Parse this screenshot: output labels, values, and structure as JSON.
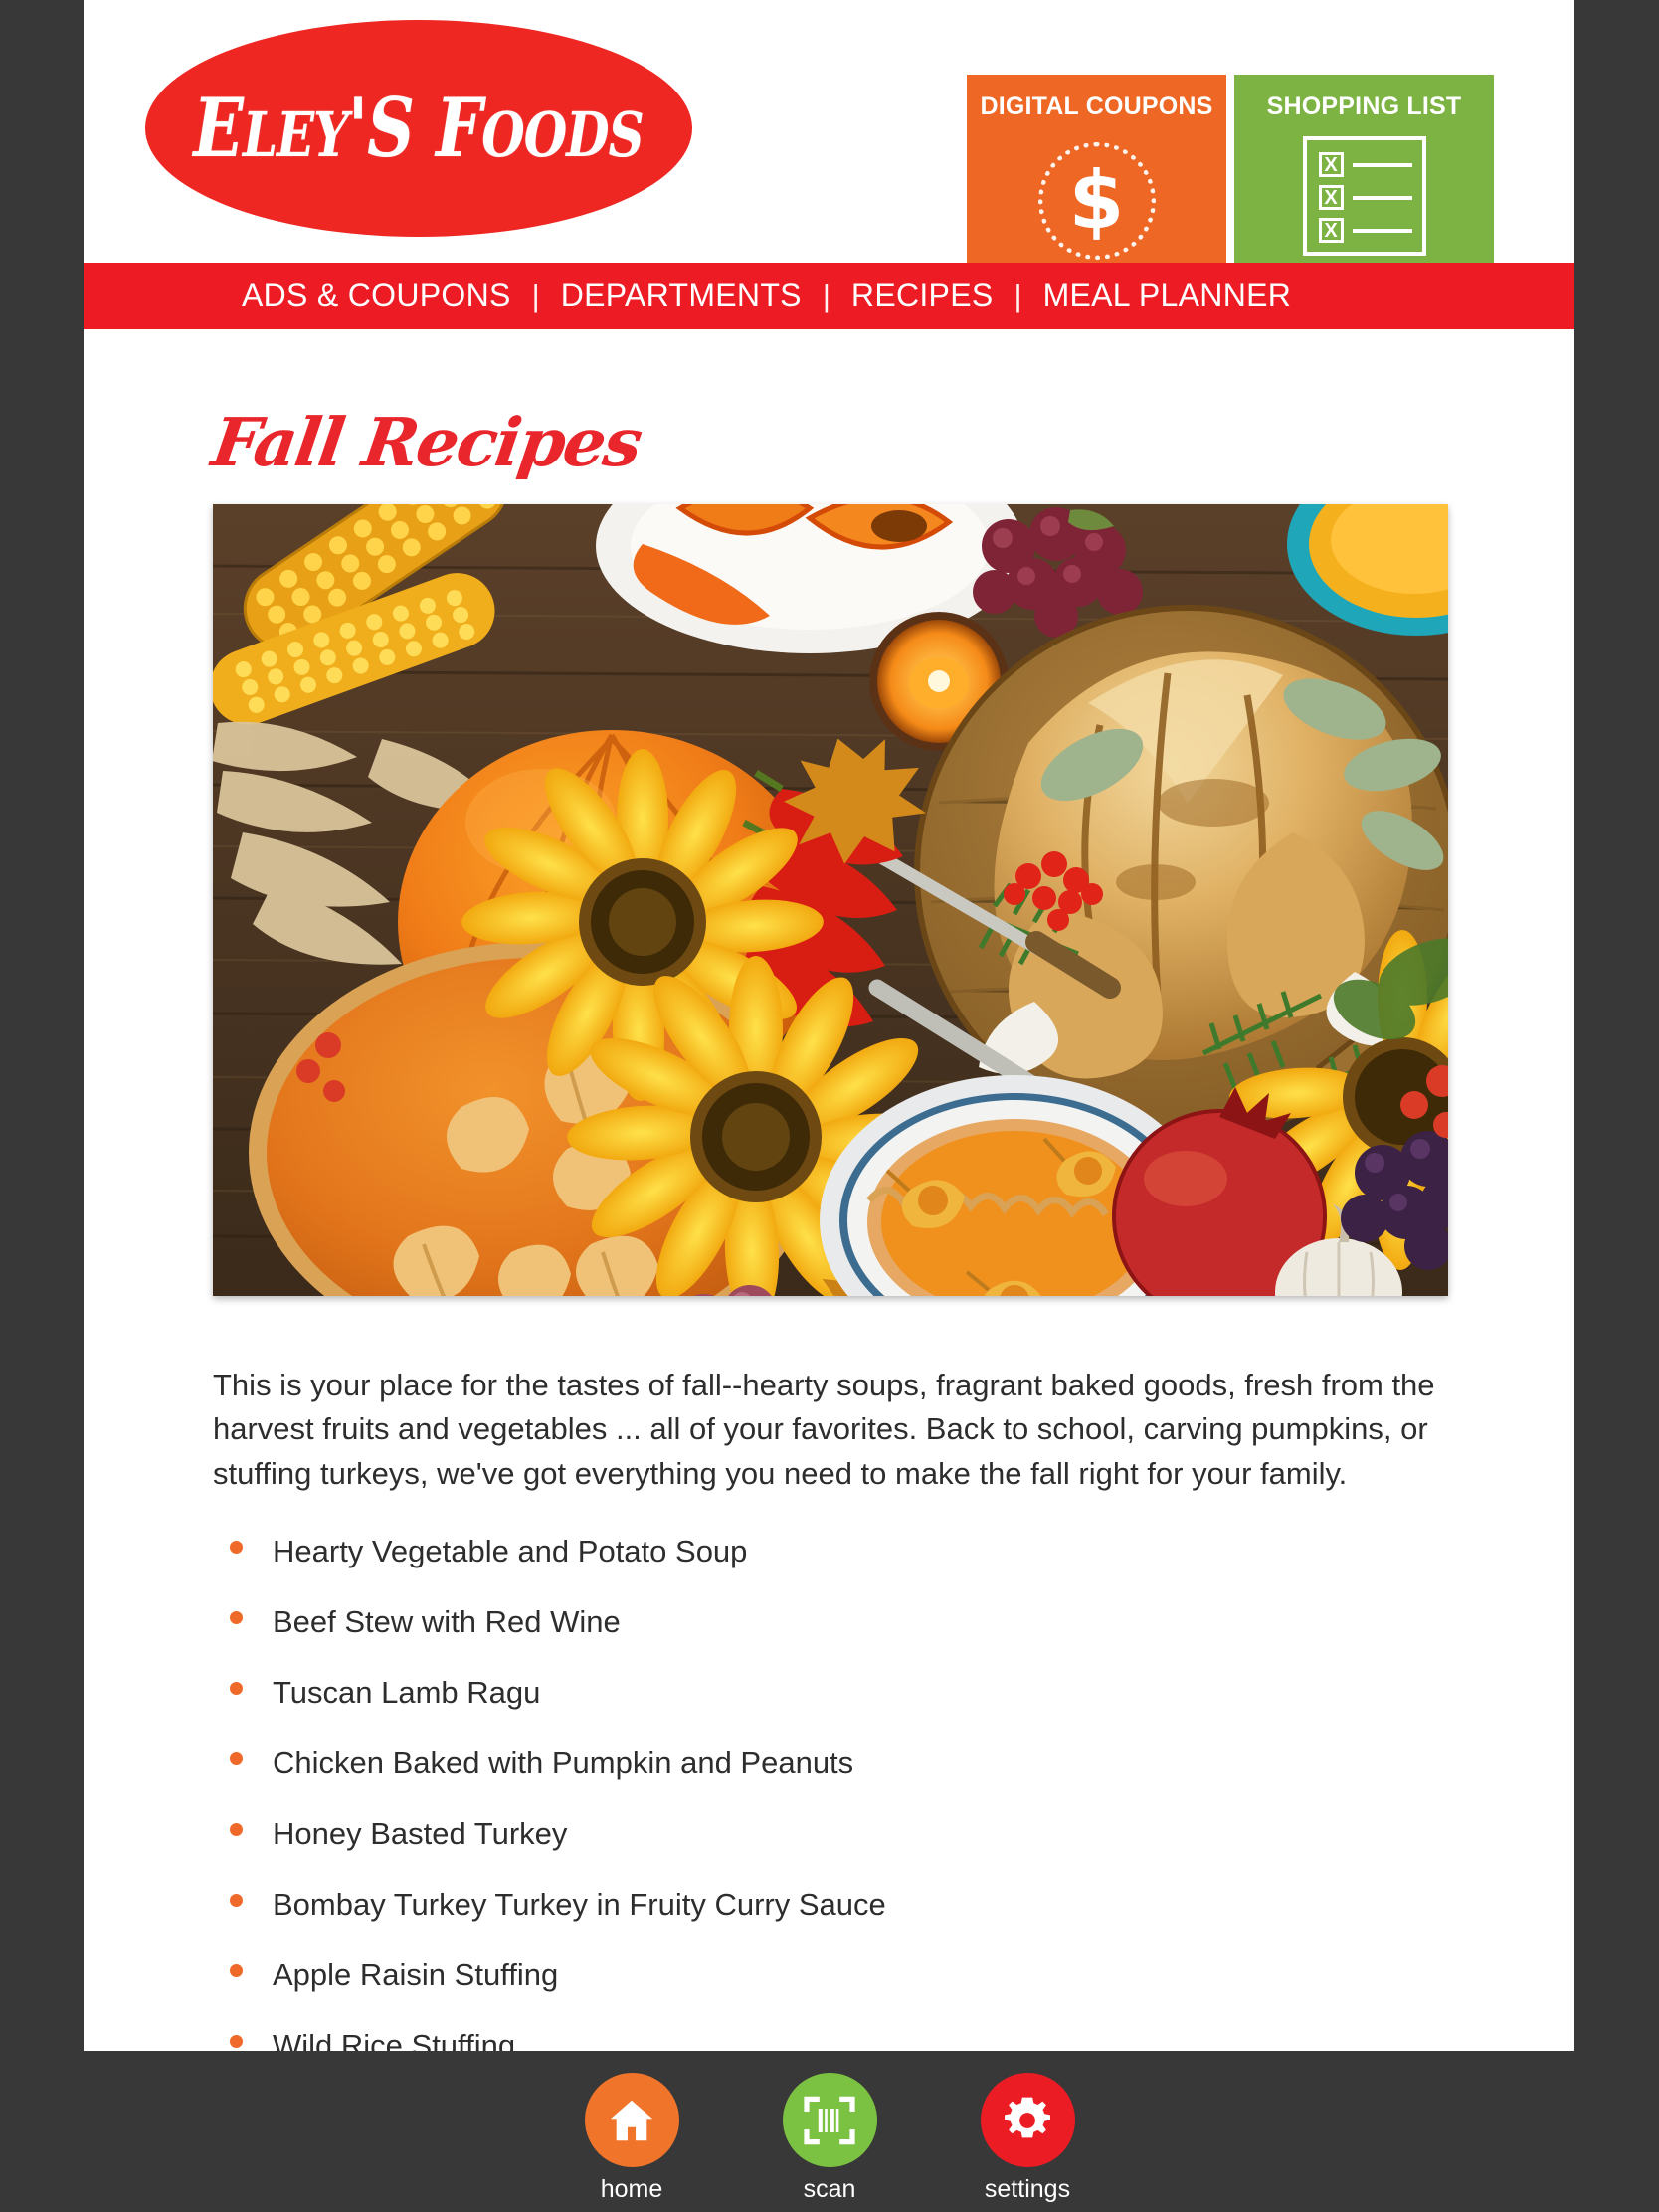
{
  "brand": {
    "name_part1": "E",
    "name_part2": "LEY",
    "name_part3": "'S F",
    "name_part4": "OODS",
    "logo_text": "ELEY'S FOODS",
    "logo_bg_color": "#EE2722",
    "accent_red": "#ED1C24",
    "accent_orange": "#EF6724",
    "accent_green": "#7CB343",
    "bullet_orange": "#EF6A2A"
  },
  "header": {
    "tiles": [
      {
        "label": "DIGITAL COUPONS",
        "icon": "dollar-coin-icon",
        "color": "#EF6724",
        "dollar_glyph": "$"
      },
      {
        "label": "SHOPPING LIST",
        "icon": "checklist-icon",
        "color": "#7CB343",
        "check_glyph": "X"
      }
    ]
  },
  "nav": {
    "separator": "|",
    "items": [
      {
        "label": "ADS & COUPONS"
      },
      {
        "label": "DEPARTMENTS"
      },
      {
        "label": "RECIPES"
      },
      {
        "label": "MEAL PLANNER"
      }
    ]
  },
  "main": {
    "page_title": "Fall Recipes",
    "hero_image_alt": "Fall harvest table with roast turkey, pumpkins, pumpkin pie, corn, sunflowers and grapes on rustic wood",
    "intro_paragraph": "This is your place for the tastes of fall--hearty soups, fragrant baked goods, fresh from the harvest fruits and vegetables ... all of your favorites. Back to school, carving pumpkins, or stuffing turkeys, we've got everything you need to make the fall right for your family.",
    "recipes": [
      {
        "label": "Hearty Vegetable and Potato Soup"
      },
      {
        "label": "Beef Stew with Red Wine"
      },
      {
        "label": "Tuscan Lamb Ragu"
      },
      {
        "label": "Chicken Baked with Pumpkin and Peanuts"
      },
      {
        "label": "Honey Basted Turkey"
      },
      {
        "label": "Bombay Turkey Turkey in Fruity Curry Sauce"
      },
      {
        "label": "Apple Raisin Stuffing"
      },
      {
        "label": "Wild Rice Stuffing"
      }
    ]
  },
  "bottom_nav": {
    "items": [
      {
        "label": "home",
        "icon": "home-icon",
        "color": "#F0742A"
      },
      {
        "label": "scan",
        "icon": "barcode-scan-icon",
        "color": "#7CC242"
      },
      {
        "label": "settings",
        "icon": "gear-icon",
        "color": "#EC1C24"
      }
    ]
  }
}
